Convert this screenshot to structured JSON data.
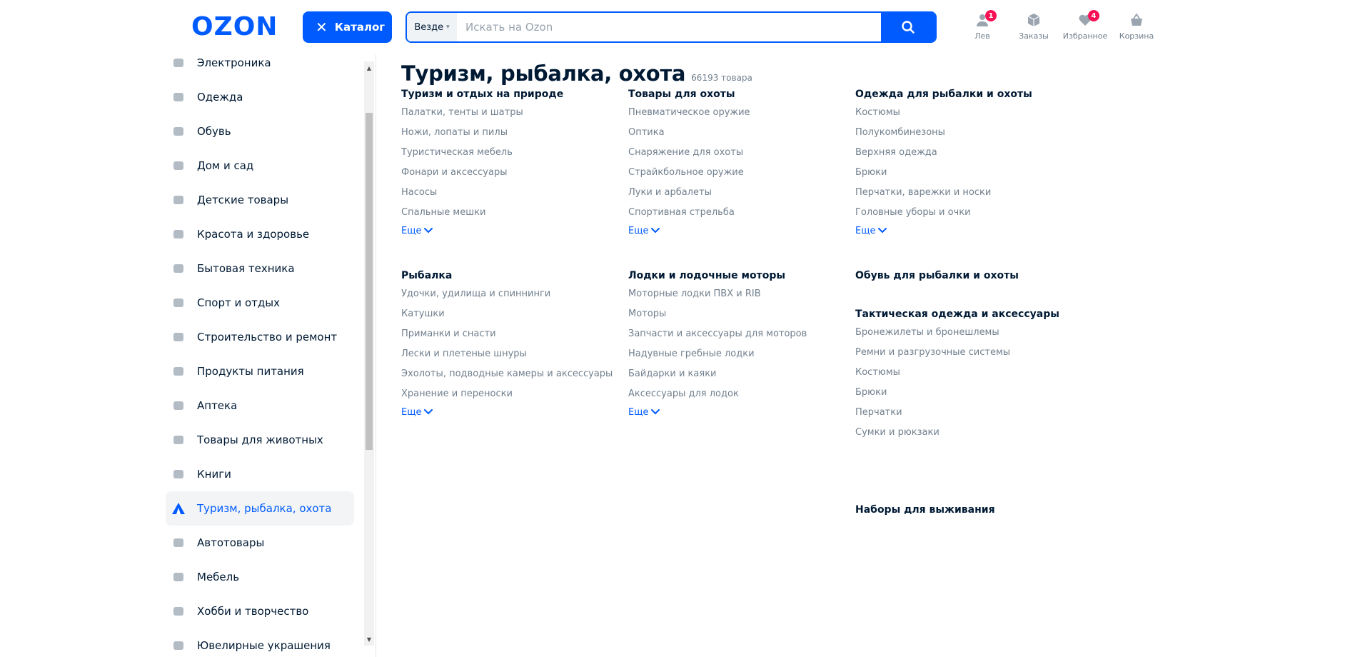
{
  "header": {
    "logo": "OZON",
    "catalog_label": "Каталог",
    "search": {
      "scope": "Везде",
      "placeholder": "Искать на Ozon",
      "value": ""
    },
    "actions": [
      {
        "name": "user",
        "label": "Лев",
        "badge": "1",
        "icon": "user-icon"
      },
      {
        "name": "orders",
        "label": "Заказы",
        "badge": "",
        "icon": "box-icon"
      },
      {
        "name": "favorites",
        "label": "Избранное",
        "badge": "4",
        "icon": "heart-icon"
      },
      {
        "name": "cart",
        "label": "Корзина",
        "badge": "",
        "icon": "basket-icon"
      }
    ]
  },
  "sidebar": {
    "items": [
      {
        "label": "Электроника",
        "icon": "laptop-icon"
      },
      {
        "label": "Одежда",
        "icon": "shirt-icon"
      },
      {
        "label": "Обувь",
        "icon": "shoe-icon"
      },
      {
        "label": "Дом и сад",
        "icon": "plant-icon"
      },
      {
        "label": "Детские товары",
        "icon": "toy-icon"
      },
      {
        "label": "Красота и здоровье",
        "icon": "cosmetics-icon"
      },
      {
        "label": "Бытовая техника",
        "icon": "appliance-icon"
      },
      {
        "label": "Спорт и отдых",
        "icon": "sport-icon"
      },
      {
        "label": "Строительство и ремонт",
        "icon": "hammer-icon"
      },
      {
        "label": "Продукты питания",
        "icon": "apple-icon"
      },
      {
        "label": "Аптека",
        "icon": "pharmacy-icon"
      },
      {
        "label": "Товары для животных",
        "icon": "pet-icon"
      },
      {
        "label": "Книги",
        "icon": "book-icon"
      },
      {
        "label": "Туризм, рыбалка, охота",
        "icon": "tent-icon",
        "active": true
      },
      {
        "label": "Автотовары",
        "icon": "car-icon"
      },
      {
        "label": "Мебель",
        "icon": "sofa-icon"
      },
      {
        "label": "Хобби и творчество",
        "icon": "palette-icon"
      },
      {
        "label": "Ювелирные украшения",
        "icon": "ring-icon"
      }
    ]
  },
  "main": {
    "title": "Туризм, рыбалка, охота",
    "count": "66193 товара",
    "more_label": "Еще",
    "columns": [
      [
        {
          "title": "Туризм и отдых на природе",
          "links": [
            "Палатки, тенты и шатры",
            "Ножи, лопаты и пилы",
            "Туристическая мебель",
            "Фонари и аксессуары",
            "Насосы",
            "Спальные мешки"
          ],
          "more": true
        },
        {
          "title": "Рыбалка",
          "links": [
            "Удочки, удилища и спиннинги",
            "Катушки",
            "Приманки и снасти",
            "Лески и плетеные шнуры",
            "Эхолоты, подводные камеры и аксессуары",
            "Хранение и переноски"
          ],
          "more": true
        }
      ],
      [
        {
          "title": "Товары для охоты",
          "links": [
            "Пневматическое оружие",
            "Оптика",
            "Снаряжение для охоты",
            "Страйкбольное оружие",
            "Луки и арбалеты",
            "Спортивная стрельба"
          ],
          "more": true
        },
        {
          "title": "Лодки и лодочные моторы",
          "links": [
            "Моторные лодки ПВХ и RIB",
            "Моторы",
            "Запчасти и аксессуары для моторов",
            "Надувные гребные лодки",
            "Байдарки и каяки",
            "Аксессуары для лодок"
          ],
          "more": true
        }
      ],
      [
        {
          "title": "Одежда для рыбалки и охоты",
          "links": [
            "Костюмы",
            "Полукомбинезоны",
            "Верхняя одежда",
            "Брюки",
            "Перчатки, варежки и носки",
            "Головные уборы и очки"
          ],
          "more": true
        },
        {
          "title": "Обувь для рыбалки и охоты",
          "links": [],
          "more": false
        },
        {
          "title": "Тактическая одежда и аксессуары",
          "links": [
            "Бронежилеты и бронешлемы",
            "Ремни и разгрузочные системы",
            "Костюмы",
            "Брюки",
            "Перчатки",
            "Сумки и рюкзаки"
          ],
          "more": false
        },
        {
          "title": "Наборы для выживания",
          "links": [],
          "more": false
        }
      ]
    ]
  }
}
